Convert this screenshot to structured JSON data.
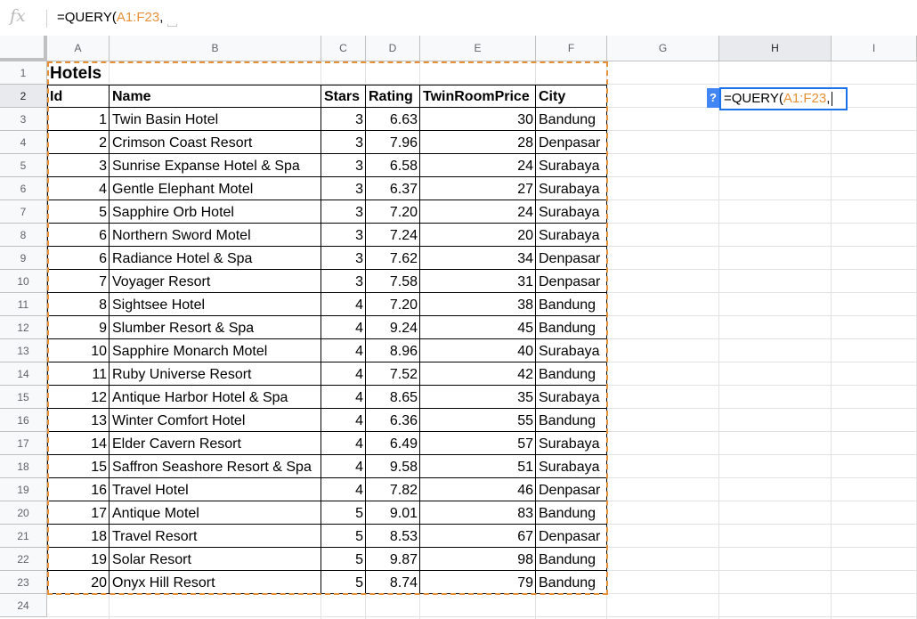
{
  "formula_bar": {
    "fx_label": "fx",
    "formula_prefix": "=QUERY(",
    "formula_ref": "A1:F23",
    "formula_suffix": ","
  },
  "columns": [
    "A",
    "B",
    "C",
    "D",
    "E",
    "F",
    "G",
    "H",
    "I"
  ],
  "active_column": "H",
  "rows": [
    "1",
    "2",
    "3",
    "4",
    "5",
    "6",
    "7",
    "8",
    "9",
    "10",
    "11",
    "12",
    "13",
    "14",
    "15",
    "16",
    "17",
    "18",
    "19",
    "20",
    "21",
    "22",
    "23",
    "24"
  ],
  "active_row": "2",
  "sheet": {
    "title": "Hotels",
    "headers": [
      "Id",
      "Name",
      "Stars",
      "Rating",
      "TwinRoomPrice",
      "City"
    ],
    "records": [
      [
        "1",
        "Twin Basin Hotel",
        "3",
        "6.63",
        "30",
        "Bandung"
      ],
      [
        "2",
        "Crimson Coast Resort",
        "3",
        "7.96",
        "28",
        "Denpasar"
      ],
      [
        "3",
        "Sunrise Expanse Hotel & Spa",
        "3",
        "6.58",
        "24",
        "Surabaya"
      ],
      [
        "4",
        "Gentle Elephant Motel",
        "3",
        "6.37",
        "27",
        "Surabaya"
      ],
      [
        "5",
        "Sapphire Orb Hotel",
        "3",
        "7.20",
        "24",
        "Surabaya"
      ],
      [
        "6",
        "Northern Sword Motel",
        "3",
        "7.24",
        "20",
        "Surabaya"
      ],
      [
        "6",
        "Radiance Hotel & Spa",
        "3",
        "7.62",
        "34",
        "Denpasar"
      ],
      [
        "7",
        "Voyager Resort",
        "3",
        "7.58",
        "31",
        "Denpasar"
      ],
      [
        "8",
        "Sightsee Hotel",
        "4",
        "7.20",
        "38",
        "Bandung"
      ],
      [
        "9",
        "Slumber Resort & Spa",
        "4",
        "9.24",
        "45",
        "Bandung"
      ],
      [
        "10",
        "Sapphire Monarch Motel",
        "4",
        "8.96",
        "40",
        "Surabaya"
      ],
      [
        "11",
        "Ruby Universe Resort",
        "4",
        "7.52",
        "42",
        "Bandung"
      ],
      [
        "12",
        "Antique Harbor Hotel & Spa",
        "4",
        "8.65",
        "35",
        "Surabaya"
      ],
      [
        "13",
        "Winter Comfort Hotel",
        "4",
        "6.36",
        "55",
        "Bandung"
      ],
      [
        "14",
        "Elder Cavern Resort",
        "4",
        "6.49",
        "57",
        "Surabaya"
      ],
      [
        "15",
        "Saffron Seashore Resort & Spa",
        "4",
        "9.58",
        "51",
        "Surabaya"
      ],
      [
        "16",
        "Travel Hotel",
        "4",
        "7.82",
        "46",
        "Denpasar"
      ],
      [
        "17",
        "Antique Motel",
        "5",
        "9.01",
        "83",
        "Bandung"
      ],
      [
        "18",
        "Travel Resort",
        "5",
        "8.53",
        "67",
        "Denpasar"
      ],
      [
        "19",
        "Solar Resort",
        "5",
        "9.87",
        "98",
        "Bandung"
      ],
      [
        "20",
        "Onyx Hill Resort",
        "5",
        "8.74",
        "79",
        "Bandung"
      ]
    ]
  },
  "editor": {
    "help_label": "?",
    "formula_prefix": "=QUERY(",
    "formula_ref": "A1:F23",
    "formula_suffix": ","
  },
  "colors": {
    "range_highlight": "#e69138",
    "active_cell_border": "#1a73e8",
    "help_badge": "#4285f4"
  }
}
